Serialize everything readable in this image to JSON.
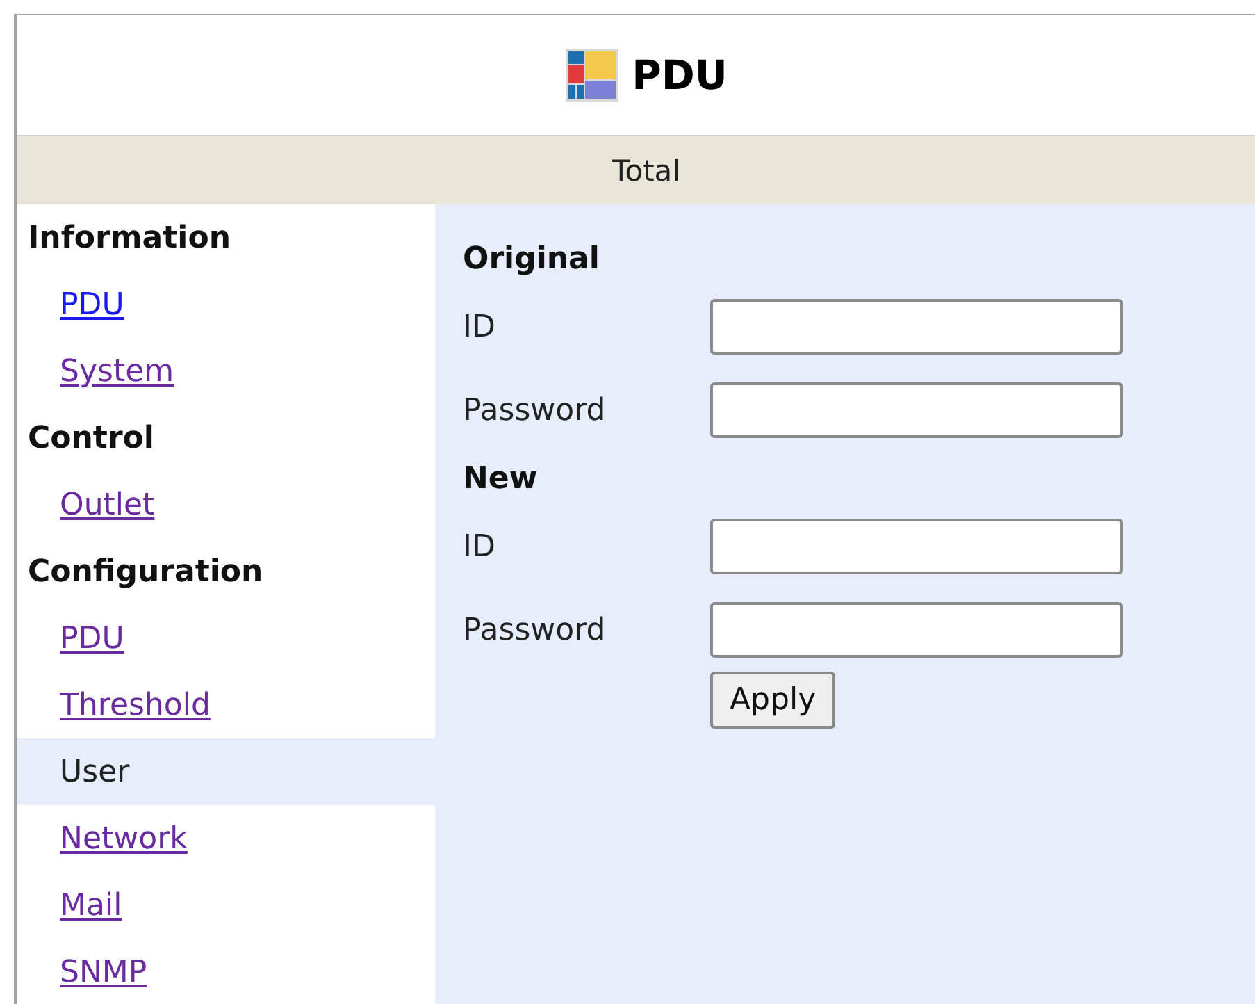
{
  "header": {
    "title": "PDU"
  },
  "subtitle_bar": {
    "text": "Total"
  },
  "sidebar": {
    "groups": [
      {
        "heading": "Information",
        "items": [
          {
            "label": "PDU",
            "visited": false,
            "selected": false
          },
          {
            "label": "System",
            "visited": true,
            "selected": false
          }
        ]
      },
      {
        "heading": "Control",
        "items": [
          {
            "label": "Outlet",
            "visited": true,
            "selected": false
          }
        ]
      },
      {
        "heading": "Configuration",
        "items": [
          {
            "label": "PDU",
            "visited": true,
            "selected": false
          },
          {
            "label": "Threshold",
            "visited": true,
            "selected": false
          },
          {
            "label": "User",
            "selected": true
          },
          {
            "label": "Network",
            "visited": true,
            "selected": false
          },
          {
            "label": "Mail",
            "visited": true,
            "selected": false
          },
          {
            "label": "SNMP",
            "visited": true,
            "selected": false
          }
        ]
      }
    ]
  },
  "form": {
    "sections": [
      {
        "heading": "Original",
        "fields": [
          {
            "label": "ID"
          },
          {
            "label": "Password"
          }
        ]
      },
      {
        "heading": "New",
        "fields": [
          {
            "label": "ID"
          },
          {
            "label": "Password"
          }
        ]
      }
    ],
    "button": "Apply"
  }
}
